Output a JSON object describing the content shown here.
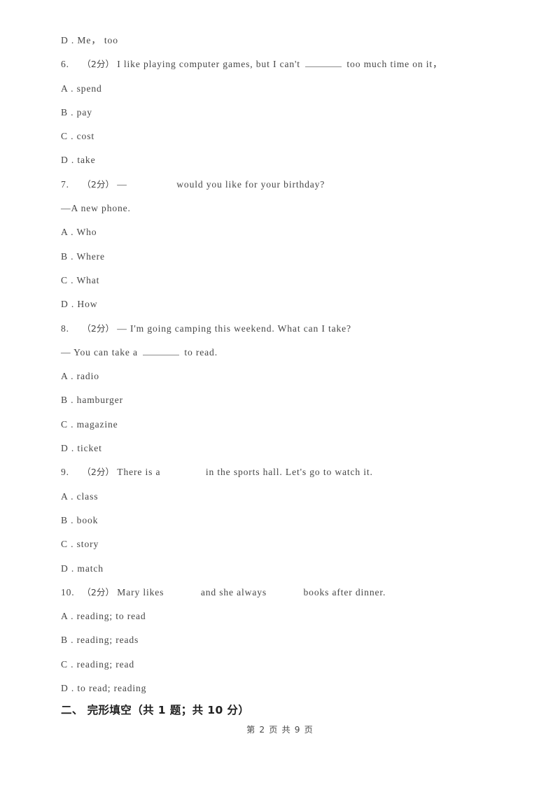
{
  "document": {
    "page_label": "第 2 页 共 9 页",
    "background_color": "#ffffff",
    "text_color": "#464646"
  },
  "orphan_option": {
    "label": "D .",
    "text": "Me，  too"
  },
  "questions": [
    {
      "number": "6.",
      "marks": "（2分）",
      "stem_before": "I like playing computer games, but I can't",
      "blank_type": "ruled",
      "stem_after": "too much time on it，",
      "options": [
        {
          "label": "A .",
          "text": "spend"
        },
        {
          "label": "B .",
          "text": "pay"
        },
        {
          "label": "C .",
          "text": "cost"
        },
        {
          "label": "D .",
          "text": "take"
        }
      ]
    },
    {
      "number": "7.",
      "marks": "（2分）",
      "stem_before": "—",
      "blank_type": "gap",
      "stem_after": "would you like for your birthday?",
      "answer_line": "—A new phone.",
      "options": [
        {
          "label": "A .",
          "text": "Who"
        },
        {
          "label": "B .",
          "text": "Where"
        },
        {
          "label": "C .",
          "text": "What"
        },
        {
          "label": "D .",
          "text": "How"
        }
      ]
    },
    {
      "number": "8.",
      "marks": "（2分）",
      "stem_before": "— I'm going camping this weekend. What can I take?",
      "blank_type": "none",
      "reply_before": "— You can take a",
      "reply_after": "to read.",
      "options": [
        {
          "label": "A .",
          "text": "radio"
        },
        {
          "label": "B .",
          "text": "hamburger"
        },
        {
          "label": "C .",
          "text": "magazine"
        },
        {
          "label": "D .",
          "text": "ticket"
        }
      ]
    },
    {
      "number": "9.",
      "marks": "（2分）",
      "stem_before": "There is a",
      "blank_type": "gap",
      "stem_after": "in the sports hall. Let's go to watch it.",
      "options": [
        {
          "label": "A .",
          "text": "class"
        },
        {
          "label": "B .",
          "text": "book"
        },
        {
          "label": "C .",
          "text": "story"
        },
        {
          "label": "D .",
          "text": "match"
        }
      ]
    },
    {
      "number": "10.",
      "marks": "（2分）",
      "stem_before": "Mary likes",
      "stem_middle": "and she always",
      "stem_after": "books after dinner.",
      "blank_type": "double-gap",
      "options": [
        {
          "label": "A .",
          "text": "reading; to read"
        },
        {
          "label": "B .",
          "text": "reading; reads"
        },
        {
          "label": "C .",
          "text": "reading; read"
        },
        {
          "label": "D .",
          "text": "to read; reading"
        }
      ]
    }
  ],
  "section": {
    "number": "二、",
    "title": "完形填空",
    "meta": "（共 1 题；共 10 分）",
    "full": "二、 完形填空（共 1 题；共 10 分）"
  }
}
